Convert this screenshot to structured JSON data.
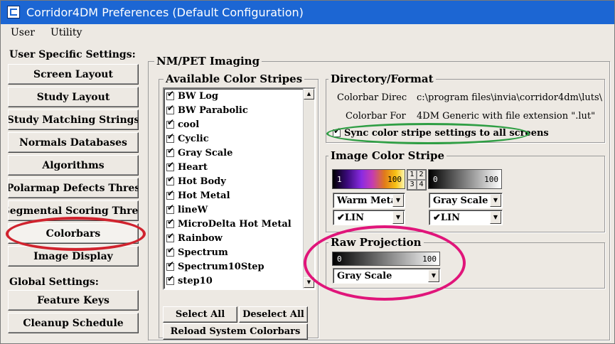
{
  "window": {
    "title": "Corridor4DM Preferences (Default Configuration)"
  },
  "menubar": {
    "items": [
      "User",
      "Utility"
    ]
  },
  "sidebar": {
    "user_header": "User Specific Settings:",
    "user_items": [
      "Screen Layout",
      "Study Layout",
      "Study Matching Strings",
      "Normals Databases",
      "Algorithms",
      "Polarmap Defects Thres",
      "Segmental Scoring Thres",
      "Colorbars",
      "Image Display"
    ],
    "global_header": "Global Settings:",
    "global_items": [
      "Feature Keys",
      "Cleanup Schedule"
    ],
    "selected": "Colorbars"
  },
  "nm_pet": {
    "title": "NM/PET Imaging",
    "stripes": {
      "title": "Available Color Stripes",
      "items": [
        "BW Log",
        "BW Parabolic",
        "cool",
        "Cyclic",
        "Gray Scale",
        "Heart",
        "Hot Body",
        "Hot Metal",
        "lineW",
        "MicroDelta Hot Metal",
        "Rainbow",
        "Spectrum",
        "Spectrum10Step",
        "step10"
      ],
      "select_all": "Select All",
      "deselect_all": "Deselect All",
      "reload": "Reload System Colorbars"
    },
    "directory": {
      "title": "Directory/Format",
      "dir_label": "Colorbar Direc",
      "dir_value": "c:\\program files\\invia\\corridor4dm\\luts\\",
      "fmt_label": "Colorbar For",
      "fmt_value": "4DM Generic with file extension \".lut\"",
      "sync_label": "Sync color stripe settings to all screens",
      "sync_checked": true
    },
    "image_color": {
      "title": "Image Color Stripe",
      "left": {
        "min": "1",
        "max": "100",
        "colormap": "Warm Metal",
        "scale": "LIN"
      },
      "grid": [
        "1",
        "2",
        "3",
        "4"
      ],
      "right": {
        "min": "0",
        "max": "100",
        "colormap": "Gray Scale",
        "scale": "LIN"
      }
    },
    "raw_projection": {
      "title": "Raw Projection",
      "min": "0",
      "max": "100",
      "colormap": "Gray Scale"
    }
  },
  "colors": {
    "titlebar": "#1c66d3",
    "highlight_red": "#d0232e",
    "highlight_green": "#2f9e44",
    "highlight_magenta": "#e0157a"
  }
}
